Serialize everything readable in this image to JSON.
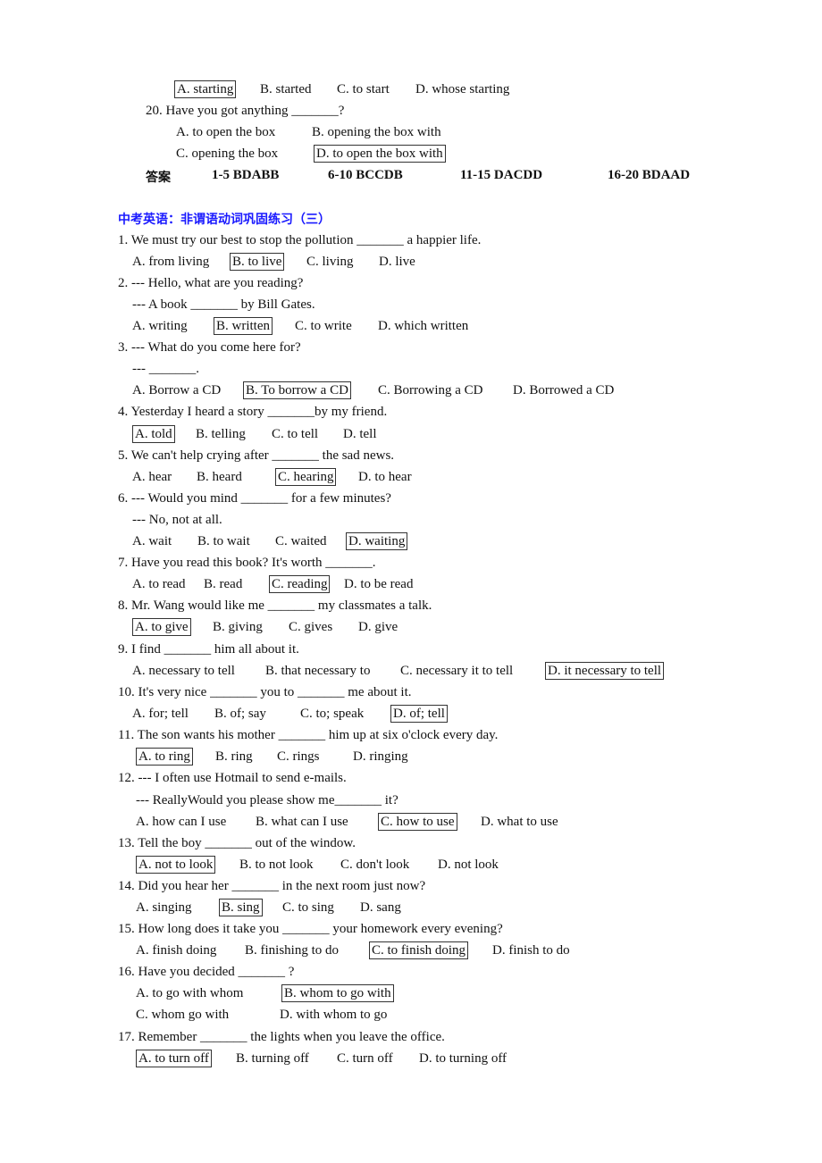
{
  "prev": {
    "q19_options": [
      "A. starting",
      "B. started",
      "C. to start",
      "D. whose starting"
    ],
    "q20_stem": "20. Have you got anything _______?",
    "q20_options": [
      "A. to open the box",
      "B. opening the box with",
      "C. opening the box",
      "D. to open the box with"
    ],
    "answer_label": "答案",
    "answers": [
      "1-5 BDABB",
      "6-10 BCCDB",
      "11-15 DACDD",
      "16-20 BDAAD"
    ]
  },
  "title": "中考英语：非谓语动词巩固练习（三）",
  "questions": [
    {
      "stem": [
        "1. We must try our best to stop the pollution _______ a happier life."
      ],
      "options": [
        "A. from living",
        "B. to live",
        "C. living",
        "D. live"
      ]
    },
    {
      "stem": [
        "2. --- Hello, what are you reading?",
        "--- A book _______ by Bill Gates."
      ],
      "options": [
        "A. writing",
        "B. written",
        "C. to write",
        "D. which written"
      ]
    },
    {
      "stem": [
        "3. --- What do you come here for?",
        "--- _______."
      ],
      "options": [
        "A. Borrow a CD",
        "B. To borrow a CD",
        "C. Borrowing a CD",
        "D. Borrowed a CD"
      ]
    },
    {
      "stem": [
        "4. Yesterday I heard a story _______by my friend."
      ],
      "options": [
        "A. told",
        "B. telling",
        "C. to tell",
        "D. tell"
      ]
    },
    {
      "stem": [
        "5. We can't help crying after _______ the sad news."
      ],
      "options": [
        "A. hear",
        "B. heard",
        "C. hearing",
        "D. to hear"
      ]
    },
    {
      "stem": [
        "6. --- Would you mind _______ for a few minutes?",
        "--- No, not at all."
      ],
      "options": [
        "A. wait",
        "B. to wait",
        "C. waited",
        "D. waiting"
      ]
    },
    {
      "stem": [
        "7. Have you read this book? It's worth _______."
      ],
      "options": [
        "A. to read",
        "B. read",
        "C. reading",
        "D. to be read"
      ]
    },
    {
      "stem": [
        "8. Mr. Wang would like me _______ my classmates a talk."
      ],
      "options": [
        "A. to give",
        "B. giving",
        "C. gives",
        "D. give"
      ]
    },
    {
      "stem": [
        "9. I find _______ him all about it."
      ],
      "options": [
        "A. necessary to tell",
        "B. that necessary to",
        "C. necessary it to tell",
        "D. it necessary to tell"
      ]
    },
    {
      "stem": [
        "10. It's very nice _______ you to _______ me about it."
      ],
      "options": [
        "A. for; tell",
        "B. of; say",
        "C. to; speak",
        "D. of; tell"
      ]
    },
    {
      "stem": [
        "11. The son wants his mother _______ him up at six o'clock every day."
      ],
      "options": [
        "A. to ring",
        "B. ring",
        "C. rings",
        "D. ringing"
      ]
    },
    {
      "stem": [
        "12. --- I often use Hotmail to send e-mails.",
        "--- ReallyWould you please show me_______ it?"
      ],
      "options": [
        "A. how can I use",
        "B. what can I use",
        "C. how to use",
        "D. what to use"
      ]
    },
    {
      "stem": [
        "13. Tell the boy _______ out of the window."
      ],
      "options": [
        "A. not to look",
        "B. to not look",
        "C. don't look",
        "D. not look"
      ]
    },
    {
      "stem": [
        "14. Did you hear her _______ in the next room just now?"
      ],
      "options": [
        "A. singing",
        "B. sing",
        "C. to sing",
        "D. sang"
      ]
    },
    {
      "stem": [
        "15. How long does it take you _______ your homework every evening?"
      ],
      "options": [
        "A. finish doing",
        "B. finishing to do",
        "C. to finish doing",
        "D. finish to do"
      ]
    },
    {
      "stem": [
        "16. Have you decided _______ ?"
      ],
      "options": [
        "A. to go with whom",
        "B. whom to go with",
        "C. whom go with",
        "D. with whom to go"
      ]
    },
    {
      "stem": [
        "17. Remember _______ the lights when you leave the office."
      ],
      "options": [
        "A. to turn off",
        "B. turning off",
        "C. turn off",
        "D. to turning off"
      ]
    }
  ]
}
